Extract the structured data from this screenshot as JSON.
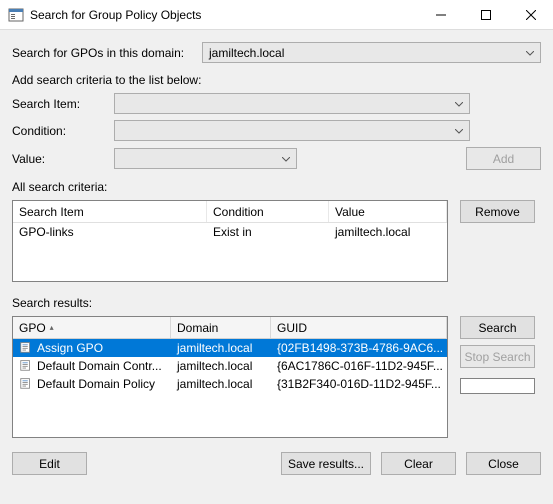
{
  "window": {
    "title": "Search for Group Policy Objects"
  },
  "domainRow": {
    "label": "Search for GPOs in this domain:",
    "value": "jamiltech.local"
  },
  "criteriaSection": {
    "heading": "Add search criteria to the list below:",
    "searchItemLabel": "Search Item:",
    "conditionLabel": "Condition:",
    "valueLabel": "Value:",
    "searchItemValue": "",
    "conditionValue": "",
    "valueValue": "",
    "addButton": "Add"
  },
  "criteriaTable": {
    "heading": "All search criteria:",
    "headers": {
      "searchItem": "Search Item",
      "condition": "Condition",
      "value": "Value"
    },
    "rows": [
      {
        "searchItem": "GPO-links",
        "condition": "Exist in",
        "value": "jamiltech.local"
      }
    ],
    "removeButton": "Remove"
  },
  "results": {
    "heading": "Search results:",
    "headers": {
      "gpo": "GPO",
      "domain": "Domain",
      "guid": "GUID"
    },
    "rows": [
      {
        "gpo": "Assign GPO",
        "domain": "jamiltech.local",
        "guid": "{02FB1498-373B-4786-9AC6...",
        "selected": true
      },
      {
        "gpo": "Default Domain Contr...",
        "domain": "jamiltech.local",
        "guid": "{6AC1786C-016F-11D2-945F...",
        "selected": false
      },
      {
        "gpo": "Default Domain Policy",
        "domain": "jamiltech.local",
        "guid": "{31B2F340-016D-11D2-945F...",
        "selected": false
      }
    ],
    "searchButton": "Search",
    "stopButton": "Stop Search"
  },
  "bottom": {
    "edit": "Edit",
    "saveResults": "Save results...",
    "clear": "Clear",
    "close": "Close"
  }
}
